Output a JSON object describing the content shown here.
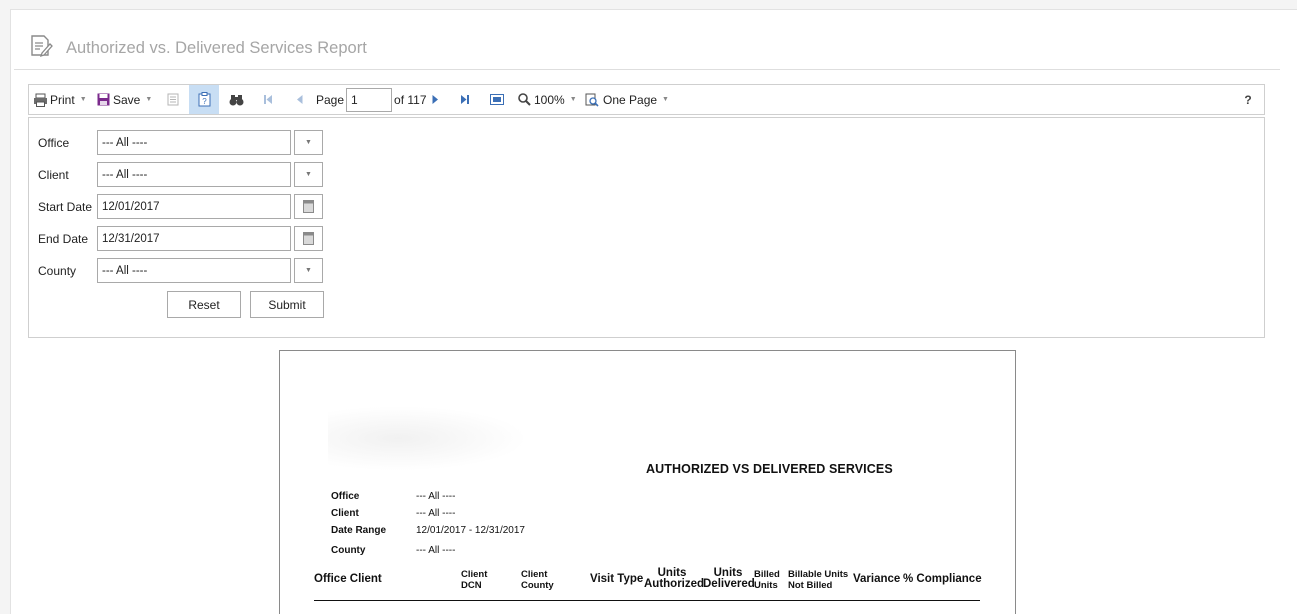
{
  "header": {
    "title": "Authorized vs. Delivered Services Report"
  },
  "toolbar": {
    "print_label": "Print",
    "save_label": "Save",
    "page_label": "Page",
    "page_value": "1",
    "page_total": "of 117",
    "zoom_label": "100%",
    "view_mode": "One Page",
    "help_label": "?"
  },
  "params": {
    "office": {
      "label": "Office",
      "value": "--- All ----"
    },
    "client": {
      "label": "Client",
      "value": "--- All ----"
    },
    "start_date": {
      "label": "Start Date",
      "value": "12/01/2017"
    },
    "end_date": {
      "label": "End Date",
      "value": "12/31/2017"
    },
    "county": {
      "label": "County",
      "value": "--- All ----"
    },
    "reset_label": "Reset",
    "submit_label": "Submit"
  },
  "report": {
    "title": "AUTHORIZED VS DELIVERED SERVICES",
    "filters": [
      {
        "label": "Office",
        "value": "--- All ----"
      },
      {
        "label": "Client",
        "value": "--- All ----"
      },
      {
        "label": "Date Range",
        "value": "12/01/2017 - 12/31/2017"
      },
      {
        "label": "County",
        "value": "--- All ----"
      }
    ],
    "columns": {
      "office_client": "Office Client",
      "client_dcn_1": "Client",
      "client_dcn_2": "DCN",
      "client_county_1": "Client",
      "client_county_2": "County",
      "visit_type": "Visit Type",
      "units_authorized_1": "Units",
      "units_authorized_2": "Authorized",
      "units_delivered_1": "Units",
      "units_delivered_2": "Delivered",
      "billed_units_1": "Billed",
      "billed_units_2": "Units",
      "billable_not_billed_1": "Billable Units",
      "billable_not_billed_2": "Not Billed",
      "variance": "Variance",
      "compliance": "% Compliance"
    }
  },
  "colors": {
    "accent_blue": "#3b6fb6",
    "save_purple": "#7b2a8c",
    "selected_bg": "#c8def4",
    "title_gray": "#a6a6a6"
  },
  "icons": {
    "header": "report-edit-icon",
    "print": "printer-icon",
    "save": "floppy-disk-icon",
    "document_map": "document-map-icon",
    "parameters": "parameters-icon",
    "find": "binoculars-icon",
    "first": "first-page-icon",
    "prev": "previous-page-icon",
    "next": "next-page-icon",
    "last": "last-page-icon",
    "full_screen": "full-screen-icon",
    "zoom": "magnifier-icon",
    "view_mode": "page-view-icon",
    "calendar": "calendar-icon"
  }
}
